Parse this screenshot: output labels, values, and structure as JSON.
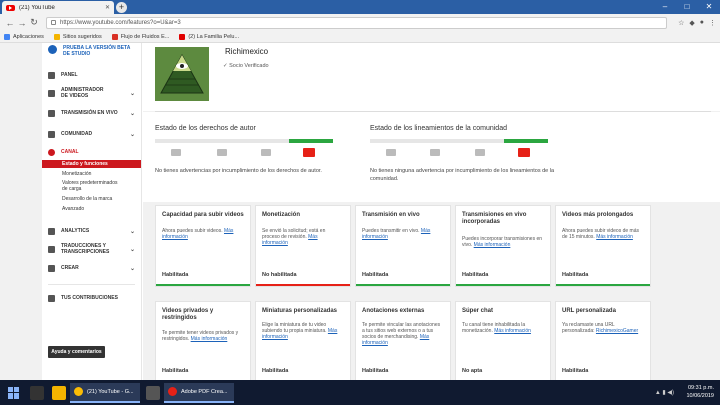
{
  "browser": {
    "tab_title": "(21) YouTube",
    "url": "https://www.youtube.com/features?o=U&ar=3",
    "bookmarks": [
      {
        "label": "Aplicaciones",
        "color": "#4285f4"
      },
      {
        "label": "Sitios sugeridos",
        "color": "#f4b400"
      },
      {
        "label": "Flujo de Fluidos E...",
        "color": "#d93025"
      },
      {
        "label": "(2) La Familia Pelu...",
        "color": "#e00000"
      }
    ]
  },
  "sidebar": {
    "beta_label": "PRUEBA LA VERSIÓN BETA DE STUDIO",
    "items": [
      {
        "label": "PANEL",
        "icon": "dashboard-icon"
      },
      {
        "label": "ADMINISTRADOR DE VIDEOS",
        "icon": "video-manager-icon"
      },
      {
        "label": "TRANSMISIÓN EN VIVO",
        "icon": "live-icon"
      },
      {
        "label": "COMUNIDAD",
        "icon": "community-icon"
      },
      {
        "label": "CANAL",
        "icon": "channel-icon"
      }
    ],
    "canal_subitems": [
      "Estado y funciones",
      "Monetización",
      "Valores predeterminados de carga",
      "Desarrollo de la marca",
      "Avanzado"
    ],
    "items2": [
      {
        "label": "ANALYTICS",
        "icon": "analytics-icon"
      },
      {
        "label": "TRADUCCIONES Y TRANSCRIPCIONES",
        "icon": "translate-icon"
      },
      {
        "label": "CREAR",
        "icon": "create-icon"
      },
      {
        "label": "TUS CONTRIBUCIONES",
        "icon": "contributions-icon"
      }
    ],
    "feedback_button": "Ayuda y comentarios"
  },
  "channel": {
    "name": "Richimexico",
    "verified": "Socio Verificado"
  },
  "copyright": {
    "title": "Estado de los derechos de autor",
    "description": "No tienes advertencias por incumplimiento de los derechos de autor."
  },
  "community": {
    "title": "Estado de los lineamientos de la comunidad",
    "description": "No tienes ninguna advertencia por incumplimiento de los lineamientos de la comunidad."
  },
  "features": [
    {
      "title": "Capacidad para subir videos",
      "desc": "Ahora puedes subir videos.",
      "link": "Más información",
      "status": "Habilitada",
      "status_color": "#2ba640"
    },
    {
      "title": "Monetización",
      "desc": "Se envió la solicitud; está en proceso de revisión.",
      "link": "Más información",
      "status": "No habilitada",
      "status_color": "#e62117"
    },
    {
      "title": "Transmisión en vivo",
      "desc": "Puedes transmitir en vivo.",
      "link": "Más información",
      "status": "Habilitada",
      "status_color": "#2ba640"
    },
    {
      "title": "Transmisiones en vivo incorporadas",
      "desc": "Puedes incorporar transmisiones en vivo.",
      "link": "Más información",
      "status": "Habilitada",
      "status_color": "#2ba640"
    },
    {
      "title": "Videos más prolongados",
      "desc": "Ahora puedes subir videos de más de 15 minutos.",
      "link": "Más información",
      "status": "Habilitada",
      "status_color": "#2ba640"
    },
    {
      "title": "Videos privados y restringidos",
      "desc": "Te permite tener videos privados y restringidos.",
      "link": "Más información",
      "status": "Habilitada",
      "status_color": "#2ba640"
    },
    {
      "title": "Miniaturas personalizadas",
      "desc": "Elige la miniatura de tu video subiendo tu propia miniatura.",
      "link": "Más información",
      "status": "Habilitada",
      "status_color": "#2ba640"
    },
    {
      "title": "Anotaciones externas",
      "desc": "Te permite vincular las anotaciones a tus sitios web externos o a tus socios de merchandising.",
      "link": "Más información",
      "status": "Habilitada",
      "status_color": "#2ba640"
    },
    {
      "title": "Súper chat",
      "desc": "Tu canal tiene inhabilitada la monetización.",
      "link": "Más información",
      "status": "No apta",
      "status_color": "#cccccc"
    },
    {
      "title": "URL personalizada",
      "desc": "Ya reclamaste una URL personalizada:",
      "link": "RichimexicoGamer",
      "status": "Habilitada",
      "status_color": "#2ba640"
    }
  ],
  "taskbar": {
    "windows": [
      {
        "label": "(21) YouTube - G...",
        "color": "#fbbc05"
      },
      {
        "label": "Adobe PDF Crea...",
        "color": "#e62117"
      }
    ],
    "time": "09:31 p.m.",
    "date": "10/06/2019"
  }
}
